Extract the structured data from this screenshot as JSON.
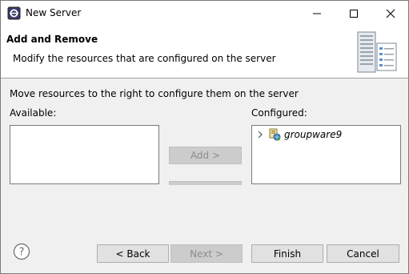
{
  "window": {
    "title": "New Server"
  },
  "banner": {
    "title": "Add and Remove",
    "description": "Modify the resources that are configured on the server"
  },
  "content": {
    "instruction": "Move resources to the right to configure them on the server",
    "available_label": "Available:",
    "configured_label": "Configured:",
    "available_items": [],
    "configured_items": [
      {
        "name": "groupware9",
        "expanded": false,
        "icon": "web-module-icon"
      }
    ],
    "add_label": "Add >",
    "add_enabled": false,
    "remove_enabled": false
  },
  "footer": {
    "back_label": "< Back",
    "next_label": "Next >",
    "finish_label": "Finish",
    "cancel_label": "Cancel",
    "next_enabled": false
  },
  "colors": {
    "button_bg": "#e1e1e1",
    "button_disabled_bg": "#cccccc",
    "dialog_bg": "#f0f0f0",
    "banner_bg": "#ffffff"
  }
}
